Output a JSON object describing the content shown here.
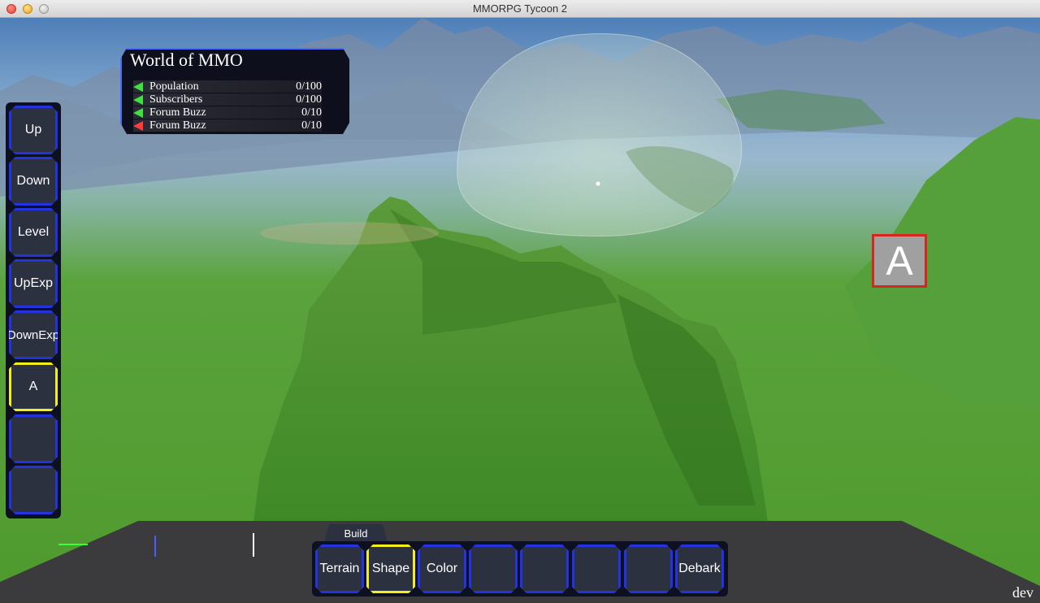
{
  "window": {
    "title": "MMORPG Tycoon 2"
  },
  "stats_panel": {
    "title": "World of MMO",
    "rows": [
      {
        "label": "Population",
        "value": "0/100",
        "arrow": "green"
      },
      {
        "label": "Subscribers",
        "value": "0/100",
        "arrow": "green"
      },
      {
        "label": "Forum Buzz",
        "value": "0/10",
        "arrow": "green"
      },
      {
        "label": "Forum Buzz",
        "value": "0/10",
        "arrow": "red"
      }
    ]
  },
  "left_toolbar": {
    "buttons": [
      {
        "label": "Up"
      },
      {
        "label": "Down"
      },
      {
        "label": "Level"
      },
      {
        "label": "UpExp"
      },
      {
        "label": "DownExp"
      },
      {
        "label": "A",
        "selected": true
      },
      {
        "label": ""
      },
      {
        "label": ""
      }
    ]
  },
  "marker": {
    "label": "A"
  },
  "bottom_toolbar": {
    "tab_label": "Build",
    "buttons": [
      {
        "label": "Terrain"
      },
      {
        "label": "Shape",
        "selected": true
      },
      {
        "label": "Color"
      },
      {
        "label": ""
      },
      {
        "label": ""
      },
      {
        "label": ""
      },
      {
        "label": ""
      },
      {
        "label": "Debark"
      }
    ]
  },
  "corner_label": "dev",
  "colors": {
    "button_border": "#2433e0",
    "selected_border": "#f2ef1a",
    "panel_bg": "#0c1020",
    "marker_border": "#d7261f",
    "arrow_up": "#40e040",
    "arrow_down": "#ff3b3b"
  }
}
